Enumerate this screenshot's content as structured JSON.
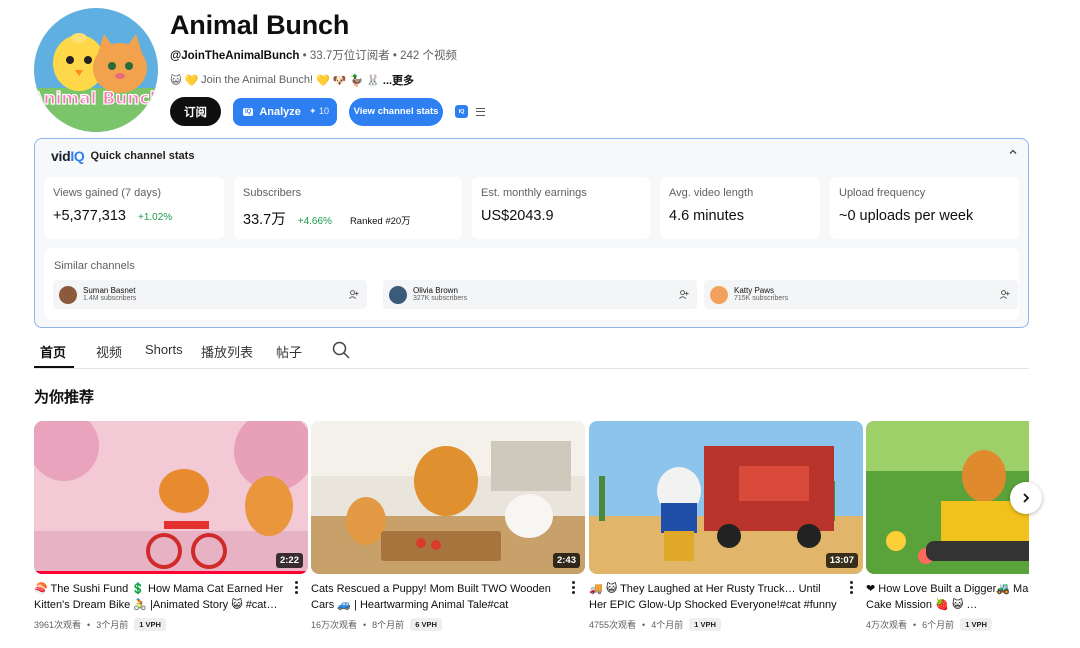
{
  "channel": {
    "title": "Animal Bunch",
    "handle": "@JoinTheAnimalBunch",
    "stats": " • 33.7万位订阅者 • 242 个视频",
    "description": "Join the Animal Bunch!",
    "more": "...更多",
    "avatar_text": "Animal Bunch",
    "subscribe_label": "订阅",
    "analyze_label": "Analyze",
    "analyze_badge": "IQ",
    "analyze_count": "✦ 10",
    "stats_button_label": "View channel stats",
    "iq_icon_label": "IQ"
  },
  "vidiq": {
    "logo_prefix": "vid",
    "logo_suffix": "IQ",
    "heading": "Quick channel stats",
    "stats": [
      {
        "label": "Views gained (7 days)",
        "value": "+5,377,313",
        "change": "+1.02%",
        "rank": ""
      },
      {
        "label": "Subscribers",
        "value": "33.7万",
        "change": "+4.66%",
        "rank": "Ranked #20万"
      },
      {
        "label": "Est. monthly earnings",
        "value": "US$2043.9",
        "change": "",
        "rank": ""
      },
      {
        "label": "Avg. video length",
        "value": "4.6 minutes",
        "change": "",
        "rank": ""
      },
      {
        "label": "Upload frequency",
        "value": "~0 uploads per week",
        "change": "",
        "rank": ""
      }
    ],
    "similar_label": "Similar channels",
    "similar": [
      {
        "name": "Suman Basnet",
        "subs": "1.4M subscribers",
        "color": "#8a5a3b"
      },
      {
        "name": "Olivia Brown",
        "subs": "327K subscribers",
        "color": "#3b5b7a"
      },
      {
        "name": "Katty Paws",
        "subs": "715K subscribers",
        "color": "#f2a25c"
      }
    ]
  },
  "tabs": [
    "首页",
    "视频",
    "Shorts",
    "播放列表",
    "帖子"
  ],
  "section_title": "为你推荐",
  "videos": [
    {
      "title": "🍣 The Sushi Fund 💲 How Mama Cat Earned Her Kitten's Dream Bike 🚴 |Animated Story 😺 #cat…",
      "duration": "2:22",
      "views": "3961次观看",
      "age": "3个月前",
      "vph": "1 VPH"
    },
    {
      "title": "Cats Rescued a Puppy! Mom Built TWO Wooden Cars 🚙 | Heartwarming Animal Tale#cat #cartoon…",
      "duration": "2:43",
      "views": "16万次观看",
      "age": "8个月前",
      "vph": "6 VPH"
    },
    {
      "title": "🚚 😺 They Laughed at Her Rusty Truck… Until Her EPIC Glow-Up Shocked Everyone!#cat #funny #cute",
      "duration": "13:07",
      "views": "4755次观看",
      "age": "4个月前",
      "vph": "1 VPH"
    },
    {
      "title": "❤ How Love Built a Digger🚜 Mama Strawberry Cake Mission 🍓 😺 …",
      "duration": "",
      "views": "4万次观看",
      "age": "6个月前",
      "vph": "1 VPH"
    }
  ],
  "colors": {
    "accent": "#2d7ff2",
    "positive": "#1d9b4a",
    "progress": "#ff0033"
  }
}
